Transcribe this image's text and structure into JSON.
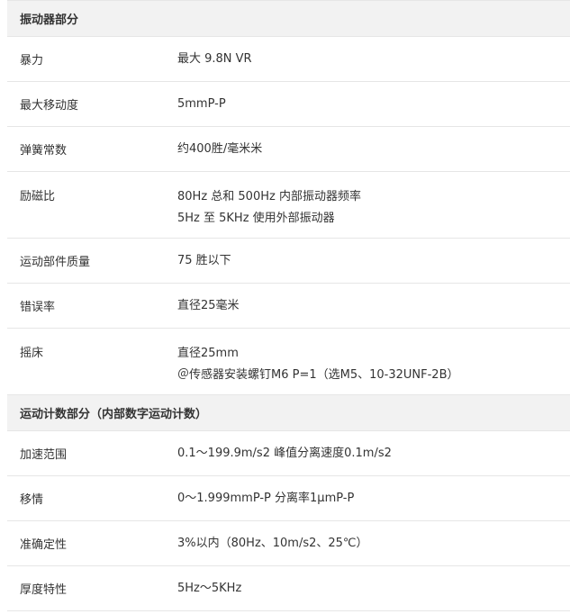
{
  "sections": [
    {
      "title": "振动器部分",
      "rows": [
        {
          "label": "暴力",
          "values": [
            "最大 9.8N VR"
          ]
        },
        {
          "label": "最大移动度",
          "values": [
            "5mmP-P"
          ]
        },
        {
          "label": "弹簧常数",
          "values": [
            "约400胜/毫米米"
          ]
        },
        {
          "label": "励磁比",
          "values": [
            "80Hz 总和 500Hz 内部振动器频率",
            "5Hz 至 5KHz 使用外部振动器"
          ]
        },
        {
          "label": "运动部件质量",
          "values": [
            "75 胜以下"
          ]
        },
        {
          "label": "错误率",
          "values": [
            "直径25毫米"
          ]
        },
        {
          "label": "摇床",
          "values": [
            "直径25mm",
            "＠传感器安装螺钉M6 P=1（选M5、10-32UNF-2B）"
          ]
        }
      ]
    },
    {
      "title": "运动计数部分（内部数字运动计数）",
      "rows": [
        {
          "label": "加速范围",
          "values": [
            "0.1～199.9m/s2 峰值分离速度0.1m/s2"
          ]
        },
        {
          "label": "移情",
          "values": [
            "0～1.999mmP-P 分离率1μmP-P"
          ]
        },
        {
          "label": "准确定性",
          "values": [
            "3%以内（80Hz、10m/s2、25℃）"
          ]
        },
        {
          "label": "厚度特性",
          "values": [
            "5Hz～5KHz"
          ]
        }
      ]
    }
  ]
}
